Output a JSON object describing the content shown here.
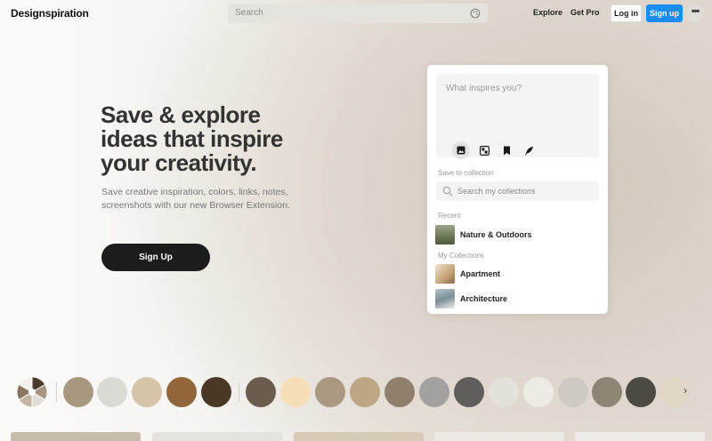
{
  "header": {
    "logo": "Designspiration",
    "search_placeholder": "Search",
    "nav": {
      "explore": "Explore",
      "get_pro": "Get Pro"
    },
    "login_label": "Log in",
    "signup_label": "Sign up",
    "more_label": "•••"
  },
  "hero": {
    "title_line1": "Save & explore",
    "title_line2": "ideas that inspire",
    "title_line3": "your creativity.",
    "subtitle_line1": "Save creative inspiration, colors, links, notes,",
    "subtitle_line2": "screenshots with our new Browser Extension.",
    "cta_label": "Sign Up"
  },
  "extension": {
    "compose_placeholder": "What inspires you?",
    "tools": [
      "image-icon",
      "screenshot-icon",
      "bookmark-icon",
      "note-icon"
    ],
    "save_to_label": "Save to collection",
    "collection_search_placeholder": "Search my collections",
    "recent_label": "Recent",
    "recent": [
      {
        "name": "Nature & Outdoors",
        "thumb_color": "#6f7a5a"
      }
    ],
    "my_collections_label": "My Collections",
    "collections": [
      {
        "name": "Apartment",
        "thumb_color": "#c9a880"
      },
      {
        "name": "Architecture",
        "thumb_color": "#7d8e96"
      }
    ]
  },
  "palette": {
    "wheel_colors": [
      "#4a3a2a",
      "#a89480",
      "#e2ddd6",
      "#c4b6a4",
      "#8a7462",
      "#f2efea"
    ],
    "colors": [
      "#a99880",
      "#dbdad5",
      "#d6c4a8",
      "#93653a",
      "#4a3826",
      "#6b5d4e",
      "#f6dfb6",
      "#ab9880",
      "#bca685",
      "#8f7f6c",
      "#a3a19f",
      "#5f5e5c",
      "#e4e1db",
      "#ecebe4",
      "#cecac3",
      "#8d8576",
      "#4c4a42",
      "#e2d7c6"
    ],
    "next_label": "›"
  },
  "grid_peek_colors": [
    "#c8bcad",
    "#e6e2dd",
    "#d7cbb8",
    "#ede9e4",
    "#efede9"
  ]
}
